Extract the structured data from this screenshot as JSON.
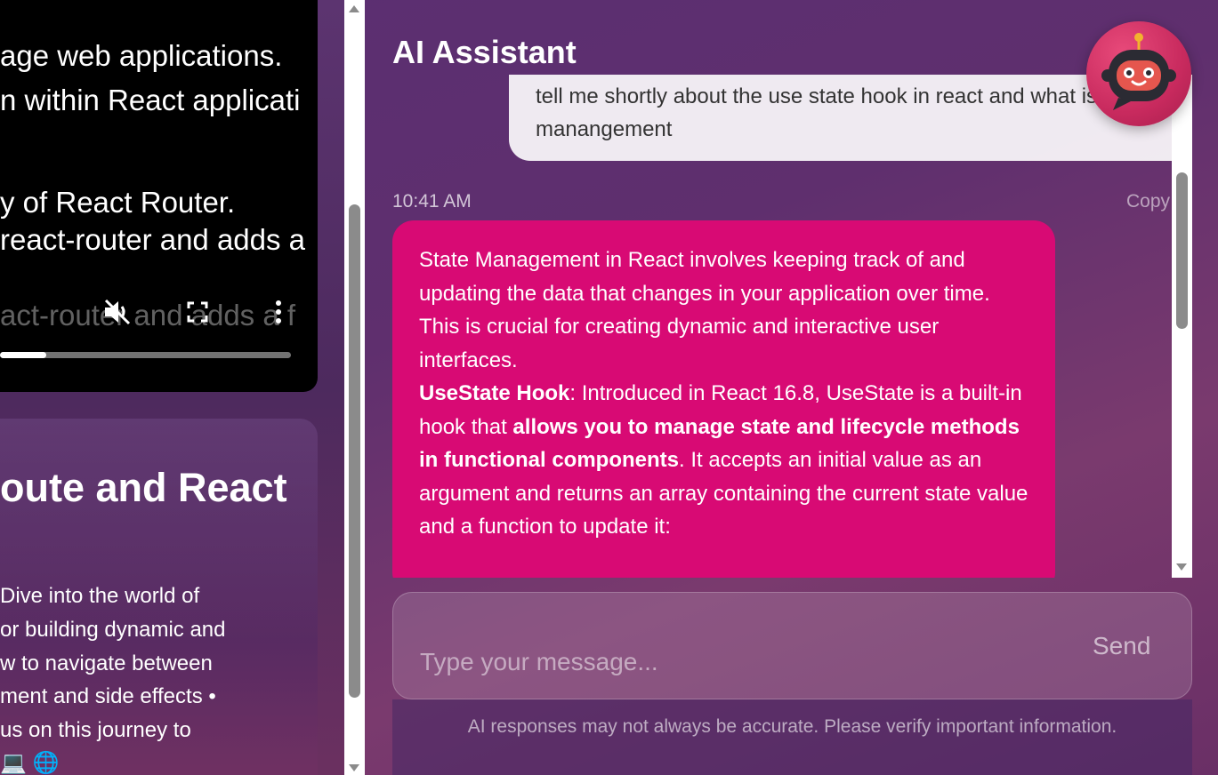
{
  "video": {
    "caption_lines": [
      "age web applications.",
      "n within React applicati",
      "y of React Router.",
      "react-router and adds a",
      "act-router and adds a f"
    ],
    "progress": 0.16,
    "icons": [
      "mute-icon",
      "fullscreen-icon",
      "more-options-icon"
    ]
  },
  "course": {
    "title": "oute and React",
    "description_lines": [
      "Dive into the world of",
      "or building dynamic and",
      "w to navigate between",
      "ment and side effects •",
      "us on this journey to"
    ],
    "emoji": [
      "💻",
      "🌐"
    ]
  },
  "chat": {
    "title": "AI Assistant",
    "user_message": "tell me shortly about the use state hook in react and what is state manangement",
    "timestamp": "10:41 AM",
    "copy_label": "Copy",
    "ai": {
      "p1": "State Management in React involves keeping track of and updating the data that changes in your application over time. This is crucial for creating dynamic and interactive user interfaces.",
      "p2_bold1": "UseState Hook",
      "p2_text1": ": Introduced in React 16.8, UseState is a built-in hook that ",
      "p2_bold2": "allows you to manage state and lifecycle methods in functional components",
      "p2_text2": ". It accepts an initial value as an argument and returns an array containing the current state value and a function to update it:"
    },
    "input_placeholder": "Type your message...",
    "send_label": "Send",
    "disclaimer": "AI responses may not always be accurate. Please verify important information."
  },
  "colors": {
    "ai_bubble": "#d80a74",
    "avatar": "#c82a5e"
  }
}
